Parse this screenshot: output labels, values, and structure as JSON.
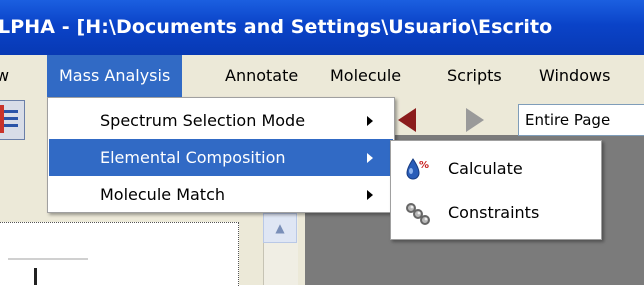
{
  "window": {
    "title": "LPHA - [H:\\Documents and Settings\\Usuario\\Escrito"
  },
  "menubar": {
    "items": [
      {
        "label": "w"
      },
      {
        "label": "Mass Analysis"
      },
      {
        "label": "Annotate"
      },
      {
        "label": "Molecule"
      },
      {
        "label": "Scripts"
      },
      {
        "label": "Windows"
      }
    ]
  },
  "mass_menu": {
    "items": [
      {
        "label": "Spectrum Selection Mode"
      },
      {
        "label": "Elemental Composition"
      },
      {
        "label": "Molecule Match"
      }
    ]
  },
  "submenu": {
    "items": [
      {
        "label": "Calculate",
        "icon": "calculate-icon"
      },
      {
        "label": "Constraints",
        "icon": "constraints-icon"
      }
    ]
  },
  "toolbar": {
    "zoom_value": "Entire Page"
  },
  "colors": {
    "title_bar": "#0a43c8",
    "highlight": "#316ac5",
    "menubar": "#ece9d8"
  }
}
